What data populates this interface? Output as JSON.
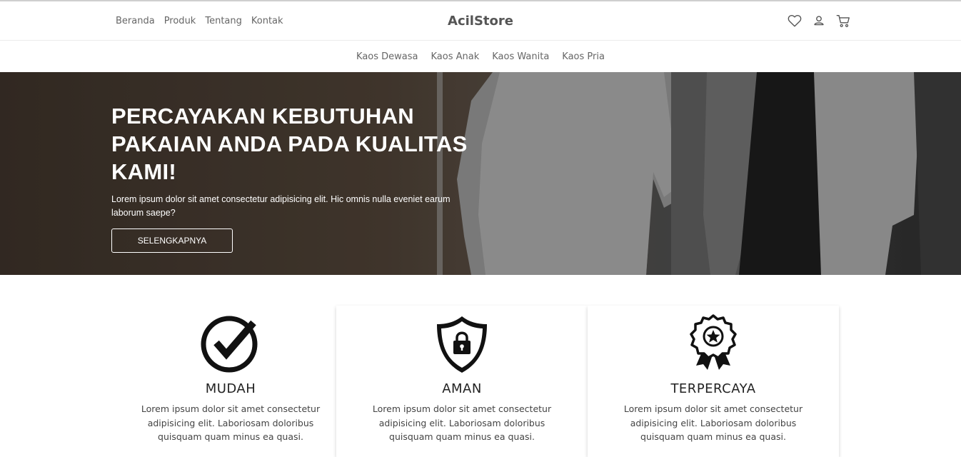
{
  "nav": {
    "links": [
      "Beranda",
      "Produk",
      "Tentang",
      "Kontak"
    ],
    "brand": "AcilStore",
    "icons": [
      "heart-icon",
      "user-icon",
      "cart-icon"
    ]
  },
  "subnav": {
    "items": [
      "Kaos Dewasa",
      "Kaos Anak",
      "Kaos Wanita",
      "Kaos Pria"
    ]
  },
  "hero": {
    "title": "PERCAYAKAN KEBUTUHAN PAKAIAN ANDA PADA KUALITAS KAMI!",
    "subtitle": "Lorem ipsum dolor sit amet consectetur adipisicing elit. Hic omnis nulla eveniet earum laborum saepe?",
    "button_label": "SELENGKAPNYA"
  },
  "features": [
    {
      "icon": "check-circle-icon",
      "title": "MUDAH",
      "text": "Lorem ipsum dolor sit amet consectetur adipisicing elit. Laboriosam doloribus quisquam quam minus ea quasi."
    },
    {
      "icon": "shield-lock-icon",
      "title": "AMAN",
      "text": "Lorem ipsum dolor sit amet consectetur adipisicing elit. Laboriosam doloribus quisquam quam minus ea quasi."
    },
    {
      "icon": "award-badge-icon",
      "title": "TERPERCAYA",
      "text": "Lorem ipsum dolor sit amet consectetur adipisicing elit. Laboriosam doloribus quisquam quam minus ea quasi."
    }
  ]
}
